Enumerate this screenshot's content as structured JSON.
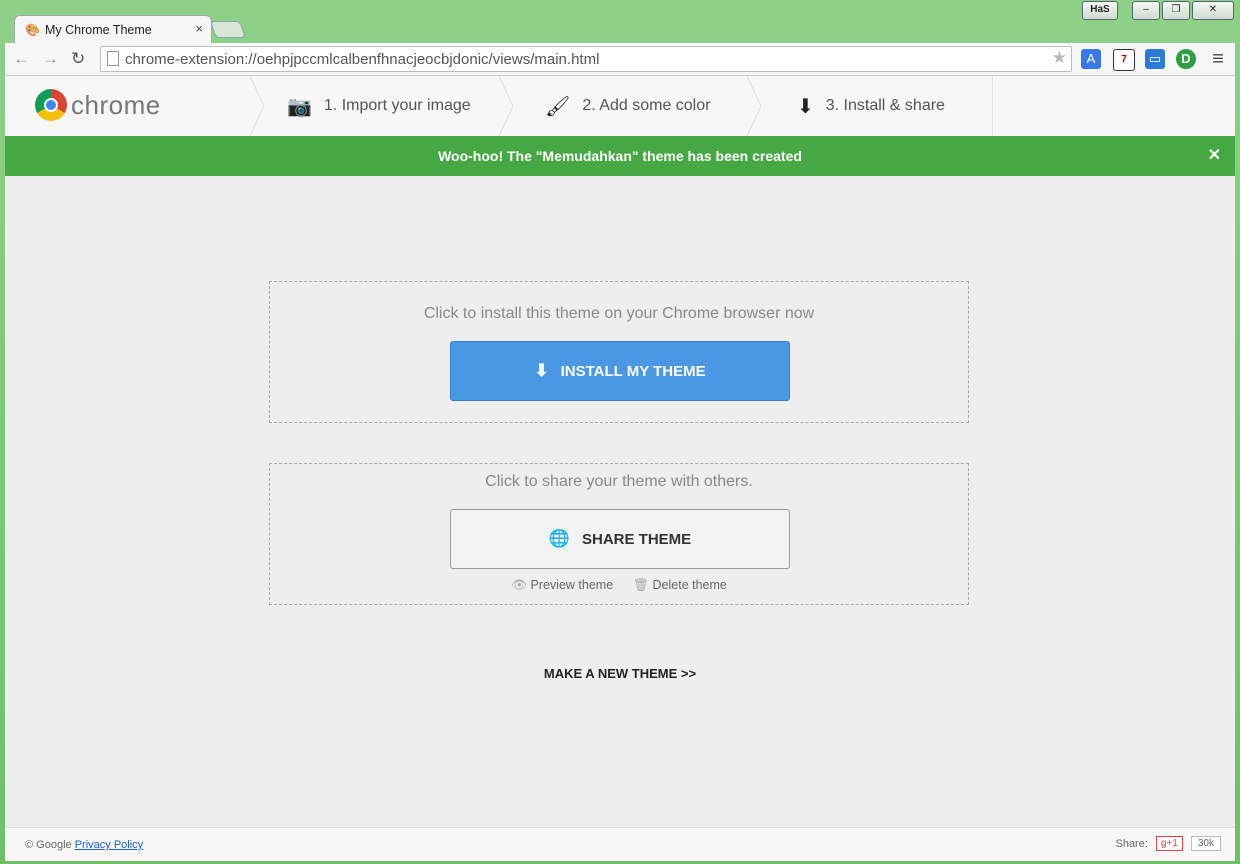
{
  "window": {
    "tab_title": "My Chrome Theme",
    "tab_close": "×",
    "has_btn": "HaS",
    "minimize": "–",
    "restore": "❐",
    "close": "✕"
  },
  "toolbar": {
    "back": "←",
    "forward": "→",
    "reload": "↻",
    "url": "chrome-extension://oehpjpccmlcalbenfhnacjeocbjdonic/views/main.html",
    "star": "★",
    "menu": "≡"
  },
  "header": {
    "logo_text": "chrome",
    "steps": [
      {
        "label": "1. Import your image"
      },
      {
        "label": "2. Add some color"
      },
      {
        "label": "3. Install & share"
      }
    ]
  },
  "notice": {
    "text": "Woo-hoo! The \"Memudahkan\" theme has been created",
    "close": "✕"
  },
  "install_box": {
    "text": "Click to install this theme on your Chrome browser now",
    "button_label": "INSTALL MY THEME"
  },
  "share_box": {
    "text": "Click to share your theme with others.",
    "button_label": "SHARE THEME",
    "preview_label": "Preview theme",
    "delete_label": "Delete theme"
  },
  "make_new": "MAKE A NEW THEME >>",
  "footer": {
    "copyright": "© Google",
    "privacy": "Privacy Policy",
    "share_label": "Share:",
    "gplus": "g+1",
    "count": "30k"
  },
  "colors": {
    "notice_green": "#45a843",
    "install_blue": "#4a98e3",
    "frame_green": "#7ec77a"
  }
}
